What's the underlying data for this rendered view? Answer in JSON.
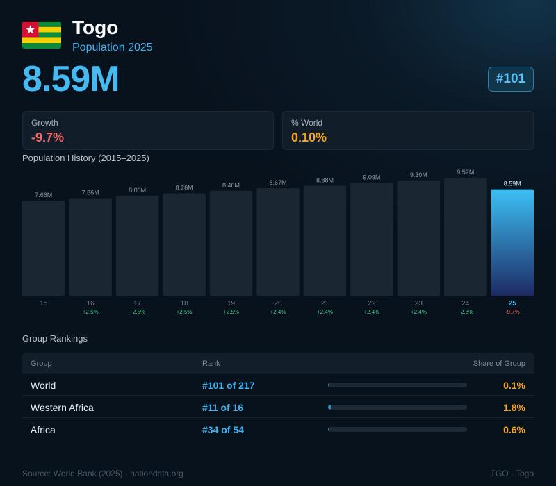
{
  "header": {
    "country": "Togo",
    "subtitle": "Population 2025",
    "population": "8.59M",
    "rank_badge": "#101",
    "flag_icon": "togo-flag-icon"
  },
  "stats": {
    "growth_label": "Growth",
    "growth_value": "-9.7%",
    "world_label": "% World",
    "world_value": "0.10%"
  },
  "chart_title": "Population History (2015–2025)",
  "chart_data": {
    "type": "bar",
    "categories": [
      "15",
      "16",
      "17",
      "18",
      "19",
      "20",
      "21",
      "22",
      "23",
      "24",
      "25"
    ],
    "values": [
      7.66,
      7.86,
      8.06,
      8.26,
      8.46,
      8.67,
      8.88,
      9.09,
      9.3,
      9.52,
      8.59
    ],
    "value_labels": [
      "7.66M",
      "7.86M",
      "8.06M",
      "8.26M",
      "8.46M",
      "8.67M",
      "8.88M",
      "9.09M",
      "9.30M",
      "9.52M",
      "8.59M"
    ],
    "growth_labels": [
      "",
      "+2.5%",
      "+2.5%",
      "+2.5%",
      "+2.5%",
      "+2.4%",
      "+2.4%",
      "+2.4%",
      "+2.4%",
      "+2.3%",
      "-9.7%"
    ],
    "unit": "M",
    "highlight_index": 10,
    "colors": {
      "bar": "#1a2632",
      "highlight_top": "#3cc0f4",
      "highlight_bottom": "#1d2a63",
      "positive": "#4fc98a",
      "negative": "#f06a6a",
      "label": "#8e99a5"
    }
  },
  "rankings": {
    "title": "Group Rankings",
    "headers": {
      "group": "Group",
      "rank": "Rank",
      "share": "Share of Group"
    },
    "rows": [
      {
        "group": "World",
        "rank": "#101 of 217",
        "share": "0.1%",
        "share_pct": 0.1
      },
      {
        "group": "Western Africa",
        "rank": "#11 of 16",
        "share": "1.8%",
        "share_pct": 1.8
      },
      {
        "group": "Africa",
        "rank": "#34 of 54",
        "share": "0.6%",
        "share_pct": 0.6
      }
    ]
  },
  "footer": {
    "source": "Source: World Bank (2025) · nationdata.org",
    "code": "TGO · Togo"
  }
}
